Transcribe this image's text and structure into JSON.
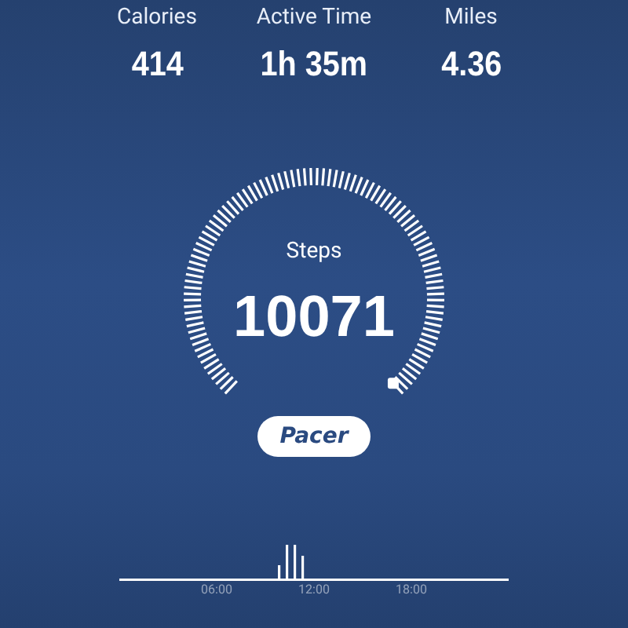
{
  "stats": [
    {
      "label": "Calories",
      "value": "414"
    },
    {
      "label": "Active Time",
      "value": "1h 35m"
    },
    {
      "label": "Miles",
      "value": "4.36"
    }
  ],
  "steps": {
    "label": "Steps",
    "value": "10071"
  },
  "logo": "Pacer",
  "activity_axis": {
    "ticks": [
      "06:00",
      "12:00",
      "18:00"
    ]
  }
}
